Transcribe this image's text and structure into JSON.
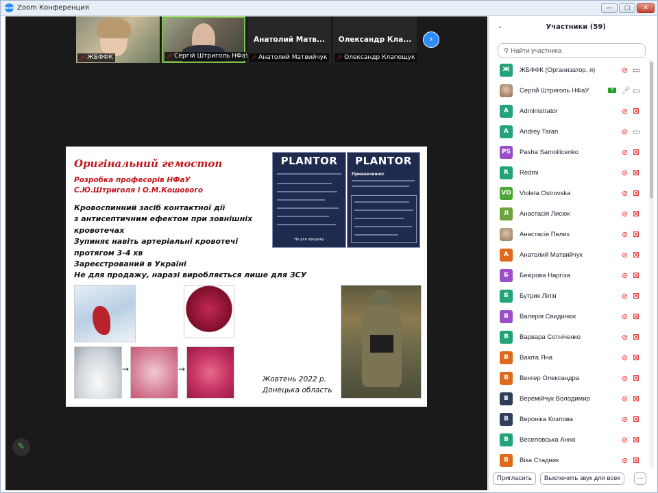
{
  "window": {
    "title": "Zoom Конференция",
    "minimize": "—",
    "maximize": "□",
    "close": "✕"
  },
  "video_strip": {
    "tiles": [
      {
        "caption": "ЖБФФК",
        "mic": "muted"
      },
      {
        "caption": "Сергій Штриголь НФаУ",
        "mic": "muted"
      },
      {
        "name": "Анатолий  Матв...",
        "caption": "Анатолий Матвийчук",
        "mic": "muted"
      },
      {
        "name": "Олександр  Кла...",
        "caption": "Олександр Клапощук",
        "mic": "muted"
      }
    ],
    "next_icon": "›"
  },
  "slide": {
    "title": "Оригінальний гемостоп",
    "subtitle_1": "Розробка професорів НФаУ",
    "subtitle_2": "С.Ю.Штриголя і О.М.Кошового",
    "body": [
      "Кровоспинний засіб контактної дії",
      "з антисептичним ефектом при зовнішніх",
      "кровотечах",
      "Зупиняє навіть артеріальні кровотечі",
      "протягом 3-4 хв",
      "Зареєстрований в Україні",
      "Не для продажу, наразі виробляється лише для ЗСУ"
    ],
    "date": "Жовтень 2022 р.",
    "region": "Донецька область",
    "package_brand": "PLANTOR",
    "package_note": "Не для продажу",
    "package_purpose": "Призначення:"
  },
  "edit_icon": "✎",
  "participants": {
    "title": "Участники (59)",
    "search_placeholder": "Найти участника",
    "list": [
      {
        "initial": "Ж",
        "name": "ЖБФФК (Организатор, я)",
        "color": "#23a37a",
        "cam": "on"
      },
      {
        "initial": "",
        "name": "Сергій Штриголь НФаУ",
        "color": "#8a6a55",
        "cam": "on",
        "sharing": true,
        "photo": true
      },
      {
        "initial": "A",
        "name": "Administrator",
        "color": "#23a37a",
        "cam": "off"
      },
      {
        "initial": "A",
        "name": "Andrey Taran",
        "color": "#23a37a",
        "cam": "on"
      },
      {
        "initial": "PS",
        "name": "Pasha Samoilicenko",
        "color": "#9b4fc6",
        "cam": "off"
      },
      {
        "initial": "R",
        "name": "Redmi",
        "color": "#23a37a",
        "cam": "off"
      },
      {
        "initial": "VO",
        "name": "Violeta Ostrovska",
        "color": "#49a836",
        "cam": "off"
      },
      {
        "initial": "Л",
        "name": "Анастасія Лисюк",
        "color": "#6ca33b",
        "cam": "off"
      },
      {
        "initial": "",
        "name": "Анастасія Пелих",
        "color": "#8a7a60",
        "cam": "off",
        "photo": true
      },
      {
        "initial": "А",
        "name": "Анатолий Матвийчук",
        "color": "#e06a1b",
        "cam": "off"
      },
      {
        "initial": "Б",
        "name": "Бекірова Наргіза",
        "color": "#9b4fc6",
        "cam": "off"
      },
      {
        "initial": "Б",
        "name": "Бутрик Лілія",
        "color": "#23a37a",
        "cam": "off"
      },
      {
        "initial": "В",
        "name": "Валерія Свидинюк",
        "color": "#9b4fc6",
        "cam": "off"
      },
      {
        "initial": "В",
        "name": "Варвара Сотніченко",
        "color": "#23a37a",
        "cam": "off"
      },
      {
        "initial": "В",
        "name": "Ваюта Яна",
        "color": "#e06a1b",
        "cam": "off"
      },
      {
        "initial": "В",
        "name": "Венгер Олександра",
        "color": "#e06a1b",
        "cam": "off"
      },
      {
        "initial": "В",
        "name": "Веремійчук Володимир",
        "color": "#2f3e5a",
        "cam": "off"
      },
      {
        "initial": "В",
        "name": "Вероніка Козлова",
        "color": "#2f3e5a",
        "cam": "off"
      },
      {
        "initial": "В",
        "name": "Веселовська Анна",
        "color": "#23a37a",
        "cam": "off"
      },
      {
        "initial": "В",
        "name": "Віка Стадник",
        "color": "#e06a1b",
        "cam": "off"
      }
    ],
    "invite_label": "Пригласить",
    "mute_all_label": "Выключить звук для всех",
    "more_label": "···"
  }
}
